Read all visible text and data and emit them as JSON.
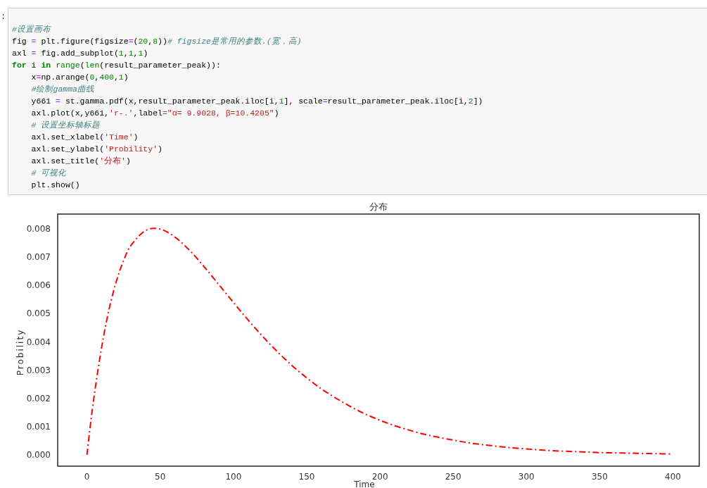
{
  "cell": {
    "prompt": ":",
    "lines": [
      {
        "indented": false,
        "tokens": [
          {
            "kind": "comment",
            "text": "#设置画布"
          }
        ]
      },
      {
        "indented": false,
        "tokens": [
          {
            "kind": "plain",
            "text": "fig "
          },
          {
            "kind": "operator",
            "text": "="
          },
          {
            "kind": "plain",
            "text": " plt.figure(figsize"
          },
          {
            "kind": "operator",
            "text": "="
          },
          {
            "kind": "plain",
            "text": "("
          },
          {
            "kind": "number",
            "text": "20"
          },
          {
            "kind": "plain",
            "text": ","
          },
          {
            "kind": "number",
            "text": "8"
          },
          {
            "kind": "plain",
            "text": "))"
          },
          {
            "kind": "comment",
            "text": "# figsize是常用的参数.(宽，高)"
          }
        ]
      },
      {
        "indented": false,
        "tokens": [
          {
            "kind": "plain",
            "text": "axl "
          },
          {
            "kind": "operator",
            "text": "="
          },
          {
            "kind": "plain",
            "text": " fig.add_subplot("
          },
          {
            "kind": "number",
            "text": "1"
          },
          {
            "kind": "plain",
            "text": ","
          },
          {
            "kind": "number",
            "text": "1"
          },
          {
            "kind": "plain",
            "text": ","
          },
          {
            "kind": "number",
            "text": "1"
          },
          {
            "kind": "plain",
            "text": ")"
          }
        ]
      },
      {
        "indented": false,
        "tokens": [
          {
            "kind": "keyword",
            "text": "for"
          },
          {
            "kind": "plain",
            "text": " i "
          },
          {
            "kind": "keyword",
            "text": "in"
          },
          {
            "kind": "builtin",
            "text": " range"
          },
          {
            "kind": "plain",
            "text": "("
          },
          {
            "kind": "builtin",
            "text": "len"
          },
          {
            "kind": "plain",
            "text": "(result_parameter_peak)):"
          }
        ]
      },
      {
        "indented": true,
        "tokens": [
          {
            "kind": "plain",
            "text": "x"
          },
          {
            "kind": "operator",
            "text": "="
          },
          {
            "kind": "plain",
            "text": "np.arange("
          },
          {
            "kind": "number",
            "text": "0"
          },
          {
            "kind": "plain",
            "text": ","
          },
          {
            "kind": "number",
            "text": "400"
          },
          {
            "kind": "plain",
            "text": ","
          },
          {
            "kind": "number",
            "text": "1"
          },
          {
            "kind": "plain",
            "text": ")"
          }
        ]
      },
      {
        "indented": true,
        "tokens": [
          {
            "kind": "comment",
            "text": "#绘制gamma曲线"
          }
        ]
      },
      {
        "indented": true,
        "tokens": [
          {
            "kind": "plain",
            "text": "y661 "
          },
          {
            "kind": "operator",
            "text": "="
          },
          {
            "kind": "plain",
            "text": " st.gamma.pdf(x,result_parameter_peak.iloc[i,"
          },
          {
            "kind": "number",
            "text": "1"
          },
          {
            "kind": "plain",
            "text": "], scale"
          },
          {
            "kind": "operator",
            "text": "="
          },
          {
            "kind": "plain",
            "text": "result_parameter_peak.iloc[i,"
          },
          {
            "kind": "number",
            "text": "2"
          },
          {
            "kind": "plain",
            "text": "])"
          }
        ]
      },
      {
        "indented": true,
        "tokens": [
          {
            "kind": "plain",
            "text": "axl.plot(x,y661,"
          },
          {
            "kind": "string",
            "text": "'r-.'"
          },
          {
            "kind": "plain",
            "text": ",label"
          },
          {
            "kind": "operator",
            "text": "="
          },
          {
            "kind": "string",
            "text": "\"α= 9.9028, β=10.4205\""
          },
          {
            "kind": "plain",
            "text": ")"
          }
        ]
      },
      {
        "indented": true,
        "tokens": [
          {
            "kind": "comment",
            "text": "# 设置坐标轴标题"
          }
        ]
      },
      {
        "indented": true,
        "tokens": [
          {
            "kind": "plain",
            "text": "axl.set_xlabel("
          },
          {
            "kind": "string",
            "text": "'Time'"
          },
          {
            "kind": "plain",
            "text": ")"
          }
        ]
      },
      {
        "indented": true,
        "tokens": [
          {
            "kind": "plain",
            "text": "axl.set_ylabel("
          },
          {
            "kind": "string",
            "text": "'Probility'"
          },
          {
            "kind": "plain",
            "text": ")"
          }
        ]
      },
      {
        "indented": true,
        "tokens": [
          {
            "kind": "plain",
            "text": "axl.set_title("
          },
          {
            "kind": "string",
            "text": "'分布'"
          },
          {
            "kind": "plain",
            "text": ")"
          }
        ]
      },
      {
        "indented": true,
        "tokens": [
          {
            "kind": "comment",
            "text": "# 可视化"
          }
        ]
      },
      {
        "indented": true,
        "tokens": [
          {
            "kind": "plain",
            "text": "plt.show()"
          }
        ]
      }
    ]
  },
  "output": {
    "chart_data": {
      "type": "line",
      "title": "分布",
      "xlabel": "Time",
      "ylabel": "Probility",
      "x": [
        0,
        2,
        5,
        10,
        15,
        20,
        25,
        30,
        40,
        50,
        60,
        70,
        80,
        90,
        100,
        110,
        120,
        130,
        140,
        150,
        160,
        170,
        180,
        190,
        200,
        210,
        220,
        230,
        240,
        250,
        260,
        270,
        280,
        290,
        300,
        310,
        320,
        330,
        340,
        350,
        360,
        370,
        380,
        390,
        399
      ],
      "series": [
        {
          "color": "#ff0000",
          "line_style": "dash-dot",
          "values": [
            0,
            0.00091,
            0.00212,
            0.0038,
            0.00512,
            0.00612,
            0.00686,
            0.00739,
            0.00792,
            0.00797,
            0.00769,
            0.00722,
            0.00664,
            0.00601,
            0.00538,
            0.00476,
            0.00418,
            0.00364,
            0.00315,
            0.00272,
            0.00233,
            0.002,
            0.0017,
            0.00144,
            0.00122,
            0.00103,
            0.00087,
            0.00073,
            0.00062,
            0.00052,
            0.00043,
            0.00036,
            0.0003,
            0.00025,
            0.00021,
            0.00017,
            0.00014,
            0.00012,
            0.0001,
            8e-05,
            7e-05,
            6e-05,
            5e-05,
            4e-05,
            3e-05
          ]
        }
      ],
      "xlim": [
        -20,
        418
      ],
      "ylim": [
        -0.0004,
        0.0085
      ],
      "xticks": [
        0,
        50,
        100,
        150,
        200,
        250,
        300,
        350,
        400
      ],
      "yticks": [
        {
          "value": 0,
          "label": "0.000"
        },
        {
          "value": 0.001,
          "label": "0.001"
        },
        {
          "value": 0.002,
          "label": "0.002"
        },
        {
          "value": 0.003,
          "label": "0.003"
        },
        {
          "value": 0.004,
          "label": "0.004"
        },
        {
          "value": 0.005,
          "label": "0.005"
        },
        {
          "value": 0.006,
          "label": "0.006"
        },
        {
          "value": 0.007,
          "label": "0.007"
        },
        {
          "value": 0.008,
          "label": "0.008"
        }
      ]
    }
  }
}
